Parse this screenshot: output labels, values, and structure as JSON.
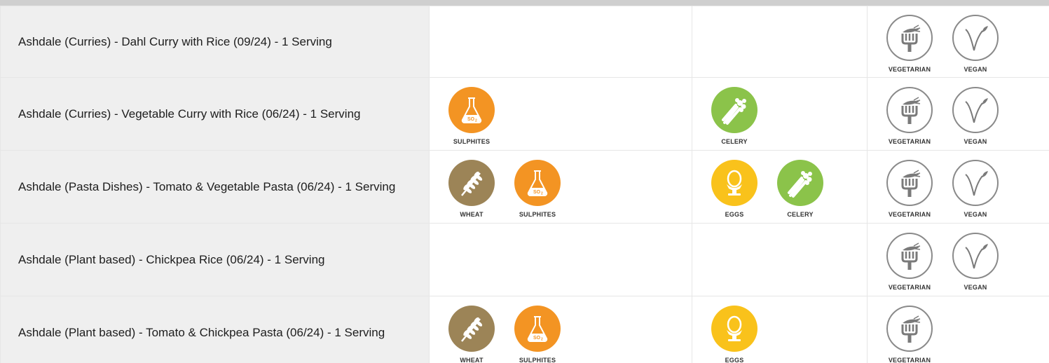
{
  "icon_defs": {
    "sulphites": {
      "label": "SULPHITES",
      "icon": "flask-so2-icon",
      "color": "#f39423",
      "style": "filled"
    },
    "celery": {
      "label": "CELERY",
      "icon": "celery-icon",
      "color": "#8bc34a",
      "style": "filled"
    },
    "wheat": {
      "label": "WHEAT",
      "icon": "wheat-icon",
      "color": "#9c8457",
      "style": "filled"
    },
    "eggs": {
      "label": "EGGS",
      "icon": "egg-cup-icon",
      "color": "#f9c21b",
      "style": "filled"
    },
    "vegetarian": {
      "label": "VEGETARIAN",
      "icon": "carrot-fork-icon",
      "color": "#8a8a8a",
      "style": "outline"
    },
    "vegan": {
      "label": "VEGAN",
      "icon": "leaf-v-icon",
      "color": "#8a8a8a",
      "style": "outline"
    }
  },
  "so2_text": "SO",
  "so2_sub": "2",
  "rows": [
    {
      "name": "Ashdale (Curries) - Dahl Curry with Rice (09/24) - 1 Serving",
      "col2": [],
      "col3": [],
      "col4": [
        "vegetarian",
        "vegan"
      ]
    },
    {
      "name": "Ashdale (Curries) - Vegetable Curry with Rice (06/24) - 1 Serving",
      "col2": [
        "sulphites"
      ],
      "col3": [
        "celery"
      ],
      "col4": [
        "vegetarian",
        "vegan"
      ]
    },
    {
      "name": "Ashdale (Pasta Dishes) - Tomato & Vegetable Pasta (06/24) - 1 Serving",
      "col2": [
        "wheat",
        "sulphites"
      ],
      "col3": [
        "eggs",
        "celery"
      ],
      "col4": [
        "vegetarian",
        "vegan"
      ]
    },
    {
      "name": "Ashdale (Plant based) - Chickpea Rice (06/24) - 1 Serving",
      "col2": [],
      "col3": [],
      "col4": [
        "vegetarian",
        "vegan"
      ]
    },
    {
      "name": "Ashdale (Plant based) - Tomato & Chickpea Pasta (06/24) - 1 Serving",
      "col2": [
        "wheat",
        "sulphites"
      ],
      "col3": [
        "eggs"
      ],
      "col4": [
        "vegetarian"
      ]
    }
  ]
}
